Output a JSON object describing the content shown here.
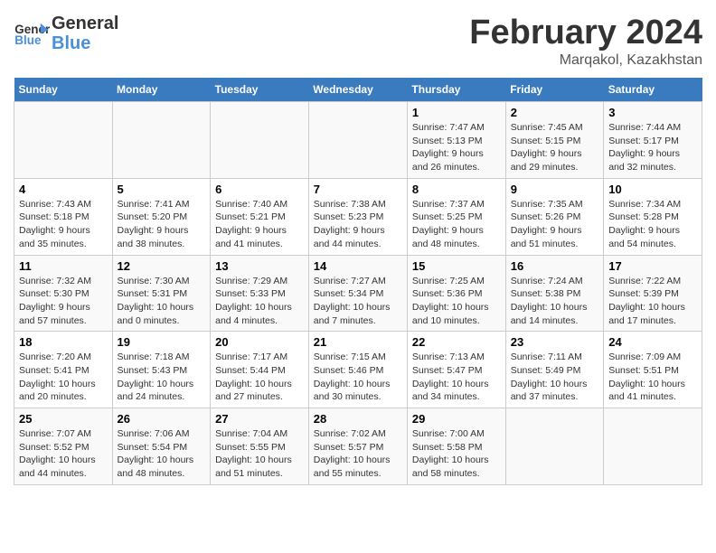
{
  "header": {
    "logo_text_general": "General",
    "logo_text_blue": "Blue",
    "main_title": "February 2024",
    "subtitle": "Marqakol, Kazakhstan"
  },
  "days_of_week": [
    "Sunday",
    "Monday",
    "Tuesday",
    "Wednesday",
    "Thursday",
    "Friday",
    "Saturday"
  ],
  "weeks": [
    [
      {
        "day": "",
        "info": ""
      },
      {
        "day": "",
        "info": ""
      },
      {
        "day": "",
        "info": ""
      },
      {
        "day": "",
        "info": ""
      },
      {
        "day": "1",
        "info": "Sunrise: 7:47 AM\nSunset: 5:13 PM\nDaylight: 9 hours and 26 minutes."
      },
      {
        "day": "2",
        "info": "Sunrise: 7:45 AM\nSunset: 5:15 PM\nDaylight: 9 hours and 29 minutes."
      },
      {
        "day": "3",
        "info": "Sunrise: 7:44 AM\nSunset: 5:17 PM\nDaylight: 9 hours and 32 minutes."
      }
    ],
    [
      {
        "day": "4",
        "info": "Sunrise: 7:43 AM\nSunset: 5:18 PM\nDaylight: 9 hours and 35 minutes."
      },
      {
        "day": "5",
        "info": "Sunrise: 7:41 AM\nSunset: 5:20 PM\nDaylight: 9 hours and 38 minutes."
      },
      {
        "day": "6",
        "info": "Sunrise: 7:40 AM\nSunset: 5:21 PM\nDaylight: 9 hours and 41 minutes."
      },
      {
        "day": "7",
        "info": "Sunrise: 7:38 AM\nSunset: 5:23 PM\nDaylight: 9 hours and 44 minutes."
      },
      {
        "day": "8",
        "info": "Sunrise: 7:37 AM\nSunset: 5:25 PM\nDaylight: 9 hours and 48 minutes."
      },
      {
        "day": "9",
        "info": "Sunrise: 7:35 AM\nSunset: 5:26 PM\nDaylight: 9 hours and 51 minutes."
      },
      {
        "day": "10",
        "info": "Sunrise: 7:34 AM\nSunset: 5:28 PM\nDaylight: 9 hours and 54 minutes."
      }
    ],
    [
      {
        "day": "11",
        "info": "Sunrise: 7:32 AM\nSunset: 5:30 PM\nDaylight: 9 hours and 57 minutes."
      },
      {
        "day": "12",
        "info": "Sunrise: 7:30 AM\nSunset: 5:31 PM\nDaylight: 10 hours and 0 minutes."
      },
      {
        "day": "13",
        "info": "Sunrise: 7:29 AM\nSunset: 5:33 PM\nDaylight: 10 hours and 4 minutes."
      },
      {
        "day": "14",
        "info": "Sunrise: 7:27 AM\nSunset: 5:34 PM\nDaylight: 10 hours and 7 minutes."
      },
      {
        "day": "15",
        "info": "Sunrise: 7:25 AM\nSunset: 5:36 PM\nDaylight: 10 hours and 10 minutes."
      },
      {
        "day": "16",
        "info": "Sunrise: 7:24 AM\nSunset: 5:38 PM\nDaylight: 10 hours and 14 minutes."
      },
      {
        "day": "17",
        "info": "Sunrise: 7:22 AM\nSunset: 5:39 PM\nDaylight: 10 hours and 17 minutes."
      }
    ],
    [
      {
        "day": "18",
        "info": "Sunrise: 7:20 AM\nSunset: 5:41 PM\nDaylight: 10 hours and 20 minutes."
      },
      {
        "day": "19",
        "info": "Sunrise: 7:18 AM\nSunset: 5:43 PM\nDaylight: 10 hours and 24 minutes."
      },
      {
        "day": "20",
        "info": "Sunrise: 7:17 AM\nSunset: 5:44 PM\nDaylight: 10 hours and 27 minutes."
      },
      {
        "day": "21",
        "info": "Sunrise: 7:15 AM\nSunset: 5:46 PM\nDaylight: 10 hours and 30 minutes."
      },
      {
        "day": "22",
        "info": "Sunrise: 7:13 AM\nSunset: 5:47 PM\nDaylight: 10 hours and 34 minutes."
      },
      {
        "day": "23",
        "info": "Sunrise: 7:11 AM\nSunset: 5:49 PM\nDaylight: 10 hours and 37 minutes."
      },
      {
        "day": "24",
        "info": "Sunrise: 7:09 AM\nSunset: 5:51 PM\nDaylight: 10 hours and 41 minutes."
      }
    ],
    [
      {
        "day": "25",
        "info": "Sunrise: 7:07 AM\nSunset: 5:52 PM\nDaylight: 10 hours and 44 minutes."
      },
      {
        "day": "26",
        "info": "Sunrise: 7:06 AM\nSunset: 5:54 PM\nDaylight: 10 hours and 48 minutes."
      },
      {
        "day": "27",
        "info": "Sunrise: 7:04 AM\nSunset: 5:55 PM\nDaylight: 10 hours and 51 minutes."
      },
      {
        "day": "28",
        "info": "Sunrise: 7:02 AM\nSunset: 5:57 PM\nDaylight: 10 hours and 55 minutes."
      },
      {
        "day": "29",
        "info": "Sunrise: 7:00 AM\nSunset: 5:58 PM\nDaylight: 10 hours and 58 minutes."
      },
      {
        "day": "",
        "info": ""
      },
      {
        "day": "",
        "info": ""
      }
    ]
  ]
}
